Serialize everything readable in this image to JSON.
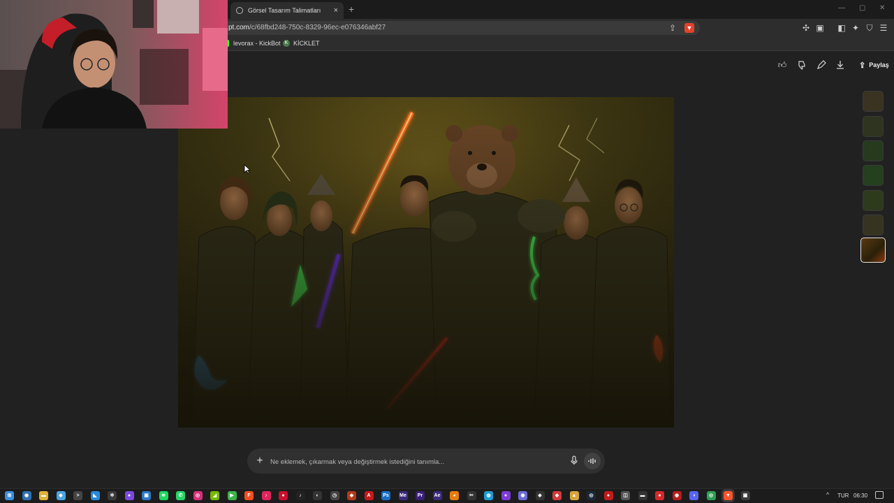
{
  "browser": {
    "tab_title": "Görsel Tasarım Talimatları",
    "tab_close": "×",
    "new_tab": "+",
    "url_prefix": "",
    "url_domain": "pt.com",
    "url_path": "/c/68fbd248-750c-8329-96ec-e076346abf27",
    "bookmarks": [
      {
        "label": "levorax - KickBot",
        "icon": "kick-icon",
        "color": "#53fc18"
      },
      {
        "label": "KİCKLET",
        "icon": "kicklet-icon",
        "color": "#4a7a4a"
      }
    ]
  },
  "header": {
    "share_label": "Paylaş"
  },
  "composer": {
    "placeholder": "Ne eklemek, çıkarmak veya değiştirmek istediğini tanımla..."
  },
  "taskbar": {
    "lang": "TUR",
    "time": "06:30",
    "apps": [
      {
        "name": "windows-start-icon",
        "color": "#3b8ddd",
        "glyph": "⊞"
      },
      {
        "name": "globe-app-icon",
        "color": "#2f6fb0",
        "glyph": "◉"
      },
      {
        "name": "file-explorer-icon",
        "color": "#e0b13a",
        "glyph": "▬"
      },
      {
        "name": "copilot-icon",
        "color": "#4aa3e0",
        "glyph": "◆"
      },
      {
        "name": "terminal-icon",
        "color": "#444444",
        "glyph": ">"
      },
      {
        "name": "vscode-icon",
        "color": "#2a8ad9",
        "glyph": "◣"
      },
      {
        "name": "chatgpt-icon",
        "color": "#3a3a3a",
        "glyph": "✲"
      },
      {
        "name": "obs-icon",
        "color": "#7a4adf",
        "glyph": "●"
      },
      {
        "name": "app-blue-icon",
        "color": "#2c79c7",
        "glyph": "▣"
      },
      {
        "name": "spotify-icon",
        "color": "#1ed760",
        "glyph": "≋"
      },
      {
        "name": "whatsapp-icon",
        "color": "#25d366",
        "glyph": "✆"
      },
      {
        "name": "instagram-icon",
        "color": "#d6307a",
        "glyph": "◎"
      },
      {
        "name": "nvidia-icon",
        "color": "#76b900",
        "glyph": "◢"
      },
      {
        "name": "play-icon",
        "color": "#3ab54a",
        "glyph": "▶"
      },
      {
        "name": "figma-icon",
        "color": "#f24e1e",
        "glyph": "F"
      },
      {
        "name": "tiktok-icon",
        "color": "#e0245e",
        "glyph": "♪"
      },
      {
        "name": "record-icon",
        "color": "#c8102e",
        "glyph": "●"
      },
      {
        "name": "tiktok-alt-icon",
        "color": "#222222",
        "glyph": "♪"
      },
      {
        "name": "steam-alt-icon",
        "color": "#333333",
        "glyph": "◐"
      },
      {
        "name": "clock-app-icon",
        "color": "#444444",
        "glyph": "◷"
      },
      {
        "name": "app-orange-icon",
        "color": "#b23a1b",
        "glyph": "◆"
      },
      {
        "name": "acrobat-icon",
        "color": "#c41a1a",
        "glyph": "A"
      },
      {
        "name": "photoshop-icon",
        "color": "#1a6fc4",
        "glyph": "Ps"
      },
      {
        "name": "media-encoder-icon",
        "color": "#3a2a7a",
        "glyph": "Me"
      },
      {
        "name": "premiere-icon",
        "color": "#3c1f78",
        "glyph": "Pr"
      },
      {
        "name": "after-effects-icon",
        "color": "#3a2a7a",
        "glyph": "Ae"
      },
      {
        "name": "blender-icon",
        "color": "#e87d0d",
        "glyph": "◕"
      },
      {
        "name": "capcut-icon",
        "color": "#333333",
        "glyph": "✂"
      },
      {
        "name": "edge-icon",
        "color": "#1f9bd3",
        "glyph": "◍"
      },
      {
        "name": "app-purple-icon",
        "color": "#7e3bd6",
        "glyph": "●"
      },
      {
        "name": "davinci-icon",
        "color": "#6b6bd6",
        "glyph": "◉"
      },
      {
        "name": "epic-icon",
        "color": "#333333",
        "glyph": "◈"
      },
      {
        "name": "app-red-icon",
        "color": "#d13b3b",
        "glyph": "◆"
      },
      {
        "name": "app-gold-icon",
        "color": "#d7a53a",
        "glyph": "▲"
      },
      {
        "name": "steam-icon",
        "color": "#1b2838",
        "glyph": "◎"
      },
      {
        "name": "app-crimson-icon",
        "color": "#c21b1b",
        "glyph": "●"
      },
      {
        "name": "app-gray-icon",
        "color": "#555555",
        "glyph": "◫"
      },
      {
        "name": "app-dark-icon",
        "color": "#333333",
        "glyph": "▬"
      },
      {
        "name": "app-red2-icon",
        "color": "#d42a2a",
        "glyph": "●"
      },
      {
        "name": "app-red3-icon",
        "color": "#b81d1d",
        "glyph": "◉"
      },
      {
        "name": "discord-icon",
        "color": "#5865f2",
        "glyph": "◑"
      },
      {
        "name": "chrome-icon",
        "color": "#2e9e54",
        "glyph": "◎"
      },
      {
        "name": "brave-icon",
        "color": "#fb542b",
        "glyph": "▼"
      },
      {
        "name": "app-box-icon",
        "color": "#3a3a3a",
        "glyph": "▣"
      }
    ]
  }
}
